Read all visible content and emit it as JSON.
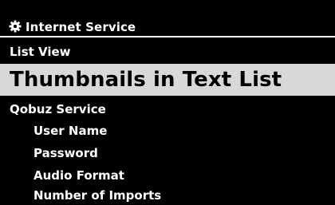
{
  "header": {
    "icon": "gear-icon",
    "title": "Internet Service"
  },
  "menu": {
    "items": [
      {
        "label": "List View",
        "level": 0,
        "selected": false
      },
      {
        "label": "Thumbnails in Text List",
        "level": 0,
        "selected": true
      },
      {
        "label": "Qobuz Service",
        "level": 0,
        "selected": false
      },
      {
        "label": "User Name",
        "level": 1,
        "selected": false
      },
      {
        "label": "Password",
        "level": 1,
        "selected": false
      },
      {
        "label": "Audio Format",
        "level": 1,
        "selected": false
      },
      {
        "label": "Number of Imports",
        "level": 1,
        "selected": false
      }
    ]
  },
  "colors": {
    "background": "#000000",
    "text": "#ffffff",
    "selection_background": "#d8d8d8",
    "selection_text": "#000000"
  }
}
